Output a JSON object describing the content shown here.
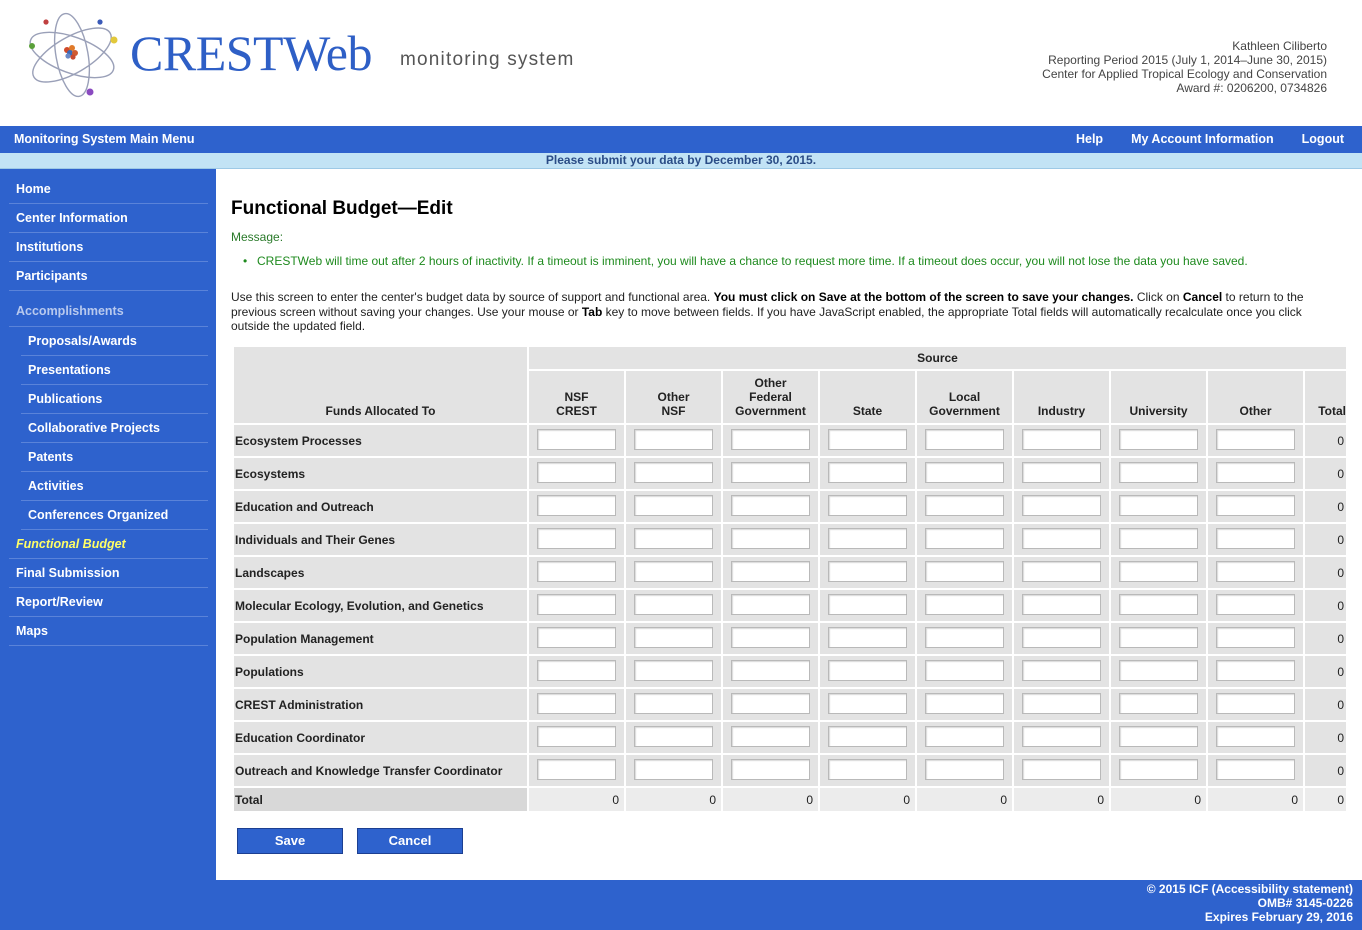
{
  "header": {
    "logo_text": "CRESTWeb",
    "logo_subtitle": "monitoring system",
    "user_name": "Kathleen Ciliberto",
    "reporting_period": "Reporting Period 2015 (July 1, 2014–June 30, 2015)",
    "center_name": "Center for Applied Tropical Ecology and Conservation",
    "award": "Award #: 0206200, 0734826"
  },
  "topnav": {
    "main_menu": "Monitoring System Main Menu",
    "help": "Help",
    "account": "My Account Information",
    "logout": "Logout"
  },
  "notice": "Please submit your data by December 30, 2015.",
  "sidebar": {
    "home": "Home",
    "center_information": "Center Information",
    "institutions": "Institutions",
    "participants": "Participants",
    "accomplishments": "Accomplishments",
    "proposals_awards": "Proposals/Awards",
    "presentations": "Presentations",
    "publications": "Publications",
    "collaborative_projects": "Collaborative Projects",
    "patents": "Patents",
    "activities": "Activities",
    "conferences_organized": "Conferences Organized",
    "functional_budget": "Functional Budget",
    "final_submission": "Final Submission",
    "report_review": "Report/Review",
    "maps": "Maps"
  },
  "page": {
    "title": "Functional Budget—Edit",
    "message_label": "Message:",
    "message": "CRESTWeb will time out after 2 hours of inactivity. If a timeout is imminent, you will have a chance to request more time. If a timeout does occur, you will not lose the data you have saved.",
    "instr_1": "Use this screen to enter the center's budget data by source of support and functional area. ",
    "instr_2": "You must click on ",
    "instr_3": "Save",
    "instr_4": " at the bottom of the screen to save your changes.",
    "instr_5": " Click on ",
    "instr_6": "Cancel",
    "instr_7": " to return to the previous screen without saving your changes. Use your mouse or ",
    "instr_8": "Tab",
    "instr_9": " key to move between fields. If you have JavaScript enabled, the appropriate Total fields will automatically recalculate once you click outside the updated field."
  },
  "table": {
    "funds_header": "Funds Allocated To",
    "source_header": "Source",
    "col_nsf_crest_1": "NSF",
    "col_nsf_crest_2": "CREST",
    "col_other_nsf_1": "Other",
    "col_other_nsf_2": "NSF",
    "col_other_fed_1": "Other",
    "col_other_fed_2": "Federal",
    "col_other_fed_3": "Government",
    "col_state": "State",
    "col_local_1": "Local",
    "col_local_2": "Government",
    "col_industry": "Industry",
    "col_university": "University",
    "col_other": "Other",
    "col_total": "Total",
    "rows": [
      {
        "label": "Ecosystem Processes",
        "total": "0"
      },
      {
        "label": "Ecosystems",
        "total": "0"
      },
      {
        "label": "Education and Outreach",
        "total": "0"
      },
      {
        "label": "Individuals and Their Genes",
        "total": "0"
      },
      {
        "label": "Landscapes",
        "total": "0"
      },
      {
        "label": "Molecular Ecology, Evolution, and Genetics",
        "total": "0"
      },
      {
        "label": "Population Management",
        "total": "0"
      },
      {
        "label": "Populations",
        "total": "0"
      },
      {
        "label": "CREST Administration",
        "total": "0"
      },
      {
        "label": "Education Coordinator",
        "total": "0"
      },
      {
        "label": "Outreach and Knowledge Transfer Coordinator",
        "total": "0"
      }
    ],
    "total_label": "Total",
    "column_totals": [
      "0",
      "0",
      "0",
      "0",
      "0",
      "0",
      "0",
      "0",
      "0"
    ]
  },
  "buttons": {
    "save": "Save",
    "cancel": "Cancel"
  },
  "footer": {
    "copyright": "© 2015 ICF (Accessibility statement)",
    "omb": "OMB# 3145-0226",
    "expires": "Expires February 29, 2016"
  },
  "colors": {
    "brand_blue": "#2e62cd",
    "notice_bg": "#c2e3f5",
    "message_green": "#1e8a1e",
    "active_nav": "#ffff66"
  }
}
